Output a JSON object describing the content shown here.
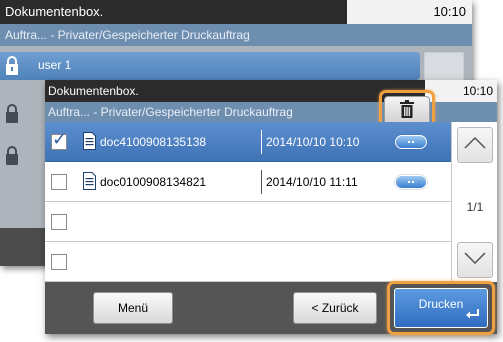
{
  "back_screen": {
    "title": "Dokumentenbox.",
    "clock": "10:10",
    "breadcrumb": "Auftra... - Privater/Gespeicherter Druckauftrag",
    "user_row": "user 1"
  },
  "front_screen": {
    "title": "Dokumentenbox.",
    "clock": "10:10",
    "breadcrumb": "Auftra... - Privater/Gespeicherter Druckauftrag",
    "rows": [
      {
        "name": "doc4100908135138",
        "date": "2014/10/10 10:10",
        "checked": true
      },
      {
        "name": "doc0100908134821",
        "date": "2014/10/10 11:11",
        "checked": false
      },
      {
        "name": "",
        "date": "",
        "checked": false
      },
      {
        "name": "",
        "date": "",
        "checked": false
      }
    ],
    "page_indicator": "1/1",
    "buttons": {
      "menu": "Menü",
      "back": "< Zurück",
      "print": "Drucken"
    }
  },
  "icons": {
    "delete": "trash-icon",
    "document": "document-icon",
    "detail": "detail-pill-icon",
    "scroll_up": "chevron-up-icon",
    "scroll_down": "chevron-down-icon",
    "lock": "lock-icon",
    "enter": "enter-icon"
  },
  "colors": {
    "accent": "#4f82ba",
    "highlight": "#f0a040",
    "topbar": "#2b2b2b"
  }
}
